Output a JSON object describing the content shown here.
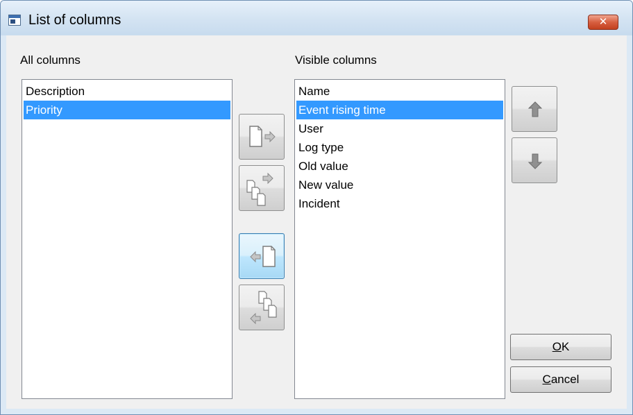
{
  "window": {
    "title": "List of columns",
    "icon": "app-window-icon",
    "close_label": "✕"
  },
  "all_columns": {
    "label": "All columns",
    "items": [
      "Description",
      "Priority"
    ],
    "selected_index": 1
  },
  "visible_columns": {
    "label": "Visible columns",
    "items": [
      "Name",
      "Event rising time",
      "User",
      "Log type",
      "Old value",
      "New value",
      "Incident"
    ],
    "selected_index": 1
  },
  "transfer_buttons": [
    {
      "name": "add-column-button",
      "icon": "page-arrow-right-icon"
    },
    {
      "name": "add-all-columns-button",
      "icon": "pages-arrow-right-icon"
    },
    {
      "name": "remove-column-button",
      "icon": "arrow-left-page-icon"
    },
    {
      "name": "remove-all-columns-button",
      "icon": "arrow-left-pages-icon"
    }
  ],
  "order_buttons": [
    {
      "name": "move-up-button",
      "icon": "arrow-up-icon"
    },
    {
      "name": "move-down-button",
      "icon": "arrow-down-icon"
    }
  ],
  "dialog_buttons": {
    "ok_mnemonic": "O",
    "ok_rest": "K",
    "cancel_mnemonic": "C",
    "cancel_rest": "ancel"
  },
  "colors": {
    "selection": "#3399ff",
    "dialog_background": "#f0f0f0",
    "close_button": "#c2401f"
  }
}
